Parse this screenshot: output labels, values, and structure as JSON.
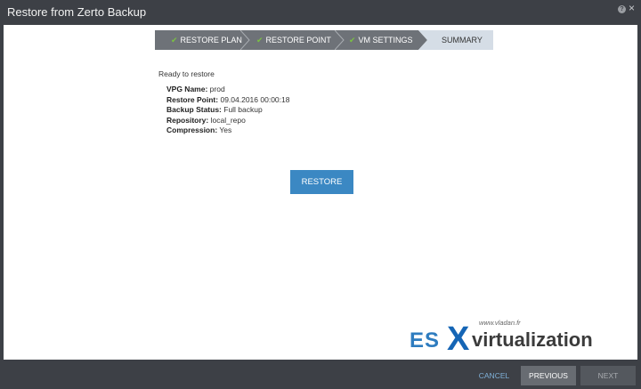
{
  "window": {
    "title": "Restore from Zerto Backup",
    "help_glyph": "?",
    "close_glyph": "×"
  },
  "steps": [
    {
      "label": "RESTORE PLAN",
      "state": "done"
    },
    {
      "label": "RESTORE POINT",
      "state": "done"
    },
    {
      "label": "VM SETTINGS",
      "state": "done"
    },
    {
      "label": "SUMMARY",
      "state": "active"
    }
  ],
  "check_glyph": "✔",
  "summary": {
    "heading": "Ready to restore",
    "rows": [
      {
        "label": "VPG Name:",
        "value": "prod"
      },
      {
        "label": "Restore Point:",
        "value": "09.04.2016 00:00:18"
      },
      {
        "label": "Backup Status:",
        "value": "Full backup"
      },
      {
        "label": "Repository:",
        "value": "local_repo"
      },
      {
        "label": "Compression:",
        "value": "Yes"
      }
    ]
  },
  "restore_button": "RESTORE",
  "watermark": {
    "url": "www.vladan.fr",
    "es": "ES",
    "x": "X",
    "rest": "virtualization"
  },
  "footer": {
    "cancel": "CANCEL",
    "previous": "PREVIOUS",
    "next": "NEXT"
  },
  "colors": {
    "chrome": "#3d4046",
    "step_done": "#6e7278",
    "step_active": "#d5dde6",
    "accent": "#3b88c3",
    "check": "#7ac143"
  }
}
